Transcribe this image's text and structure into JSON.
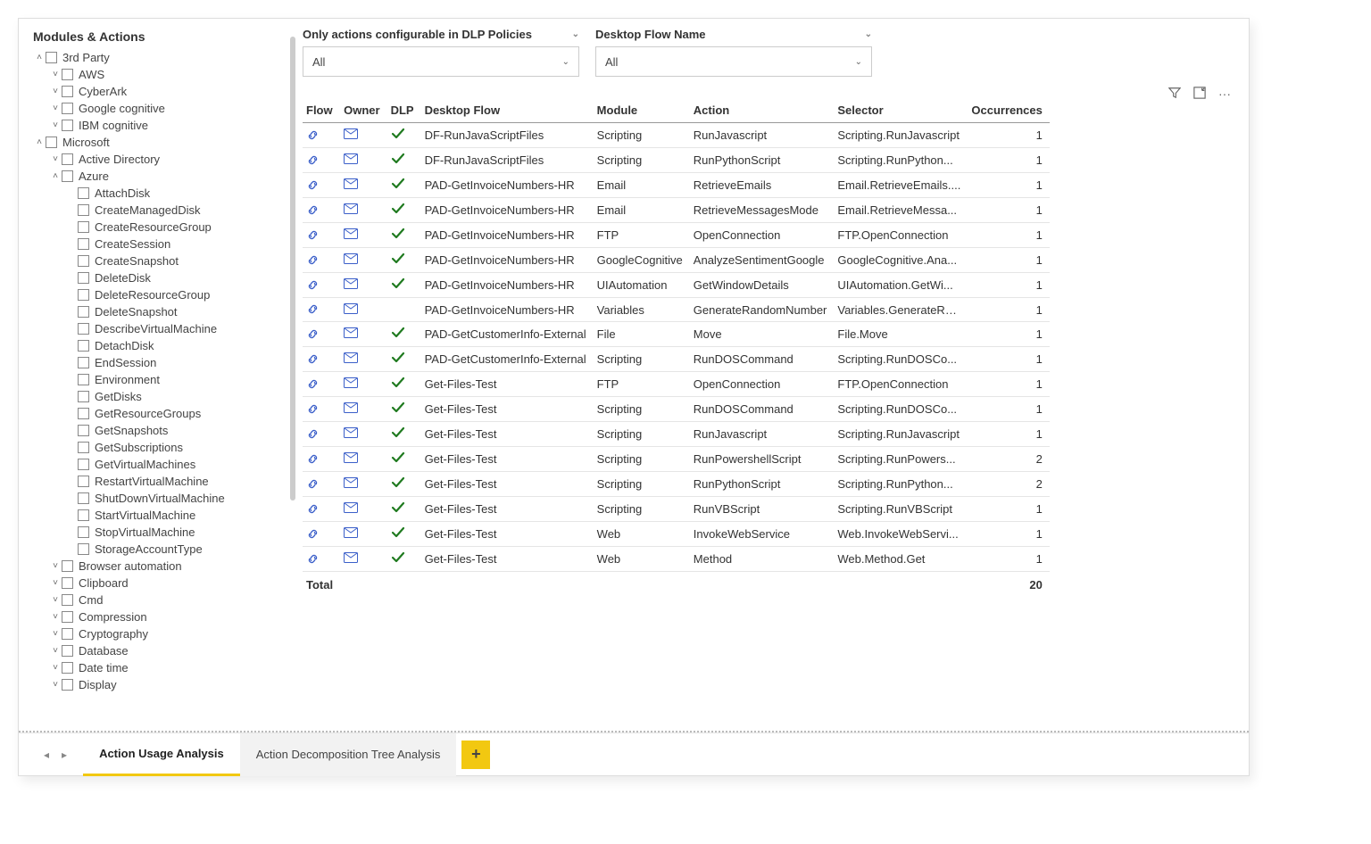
{
  "sidebar": {
    "title": "Modules & Actions",
    "tree": [
      {
        "level": 1,
        "chev": "up",
        "label": "3rd Party"
      },
      {
        "level": 2,
        "chev": "down",
        "label": "AWS"
      },
      {
        "level": 2,
        "chev": "down",
        "label": "CyberArk"
      },
      {
        "level": 2,
        "chev": "down",
        "label": "Google cognitive"
      },
      {
        "level": 2,
        "chev": "down",
        "label": "IBM cognitive"
      },
      {
        "level": 1,
        "chev": "up",
        "label": "Microsoft"
      },
      {
        "level": 2,
        "chev": "down",
        "label": "Active Directory"
      },
      {
        "level": 2,
        "chev": "up",
        "label": "Azure"
      },
      {
        "level": 3,
        "chev": "none",
        "label": "AttachDisk"
      },
      {
        "level": 3,
        "chev": "none",
        "label": "CreateManagedDisk"
      },
      {
        "level": 3,
        "chev": "none",
        "label": "CreateResourceGroup"
      },
      {
        "level": 3,
        "chev": "none",
        "label": "CreateSession"
      },
      {
        "level": 3,
        "chev": "none",
        "label": "CreateSnapshot"
      },
      {
        "level": 3,
        "chev": "none",
        "label": "DeleteDisk"
      },
      {
        "level": 3,
        "chev": "none",
        "label": "DeleteResourceGroup"
      },
      {
        "level": 3,
        "chev": "none",
        "label": "DeleteSnapshot"
      },
      {
        "level": 3,
        "chev": "none",
        "label": "DescribeVirtualMachine"
      },
      {
        "level": 3,
        "chev": "none",
        "label": "DetachDisk"
      },
      {
        "level": 3,
        "chev": "none",
        "label": "EndSession"
      },
      {
        "level": 3,
        "chev": "none",
        "label": "Environment"
      },
      {
        "level": 3,
        "chev": "none",
        "label": "GetDisks"
      },
      {
        "level": 3,
        "chev": "none",
        "label": "GetResourceGroups"
      },
      {
        "level": 3,
        "chev": "none",
        "label": "GetSnapshots"
      },
      {
        "level": 3,
        "chev": "none",
        "label": "GetSubscriptions"
      },
      {
        "level": 3,
        "chev": "none",
        "label": "GetVirtualMachines"
      },
      {
        "level": 3,
        "chev": "none",
        "label": "RestartVirtualMachine"
      },
      {
        "level": 3,
        "chev": "none",
        "label": "ShutDownVirtualMachine"
      },
      {
        "level": 3,
        "chev": "none",
        "label": "StartVirtualMachine"
      },
      {
        "level": 3,
        "chev": "none",
        "label": "StopVirtualMachine"
      },
      {
        "level": 3,
        "chev": "none",
        "label": "StorageAccountType"
      },
      {
        "level": 2,
        "chev": "down",
        "label": "Browser automation"
      },
      {
        "level": 2,
        "chev": "down",
        "label": "Clipboard"
      },
      {
        "level": 2,
        "chev": "down",
        "label": "Cmd"
      },
      {
        "level": 2,
        "chev": "down",
        "label": "Compression"
      },
      {
        "level": 2,
        "chev": "down",
        "label": "Cryptography"
      },
      {
        "level": 2,
        "chev": "down",
        "label": "Database"
      },
      {
        "level": 2,
        "chev": "down",
        "label": "Date time"
      },
      {
        "level": 2,
        "chev": "down",
        "label": "Display"
      }
    ]
  },
  "filters": {
    "dlp_label": "Only actions configurable in DLP Policies",
    "dlp_value": "All",
    "flowname_label": "Desktop Flow Name",
    "flowname_value": "All"
  },
  "table": {
    "headers": {
      "flow": "Flow",
      "owner": "Owner",
      "dlp": "DLP",
      "name": "Desktop Flow",
      "module": "Module",
      "action": "Action",
      "selector": "Selector",
      "occ": "Occurrences"
    },
    "rows": [
      {
        "dlp": true,
        "name": "DF-RunJavaScriptFiles",
        "module": "Scripting",
        "action": "RunJavascript",
        "selector": "Scripting.RunJavascript",
        "occ": 1
      },
      {
        "dlp": true,
        "name": "DF-RunJavaScriptFiles",
        "module": "Scripting",
        "action": "RunPythonScript",
        "selector": "Scripting.RunPython...",
        "occ": 1
      },
      {
        "dlp": true,
        "name": "PAD-GetInvoiceNumbers-HR",
        "module": "Email",
        "action": "RetrieveEmails",
        "selector": "Email.RetrieveEmails....",
        "occ": 1
      },
      {
        "dlp": true,
        "name": "PAD-GetInvoiceNumbers-HR",
        "module": "Email",
        "action": "RetrieveMessagesMode",
        "selector": "Email.RetrieveMessa...",
        "occ": 1
      },
      {
        "dlp": true,
        "name": "PAD-GetInvoiceNumbers-HR",
        "module": "FTP",
        "action": "OpenConnection",
        "selector": "FTP.OpenConnection",
        "occ": 1
      },
      {
        "dlp": true,
        "name": "PAD-GetInvoiceNumbers-HR",
        "module": "GoogleCognitive",
        "action": "AnalyzeSentimentGoogle",
        "selector": "GoogleCognitive.Ana...",
        "occ": 1
      },
      {
        "dlp": true,
        "name": "PAD-GetInvoiceNumbers-HR",
        "module": "UIAutomation",
        "action": "GetWindowDetails",
        "selector": "UIAutomation.GetWi...",
        "occ": 1
      },
      {
        "dlp": false,
        "name": "PAD-GetInvoiceNumbers-HR",
        "module": "Variables",
        "action": "GenerateRandomNumber",
        "selector": "Variables.GenerateRa...",
        "occ": 1
      },
      {
        "dlp": true,
        "name": "PAD-GetCustomerInfo-External",
        "module": "File",
        "action": "Move",
        "selector": "File.Move",
        "occ": 1
      },
      {
        "dlp": true,
        "name": "PAD-GetCustomerInfo-External",
        "module": "Scripting",
        "action": "RunDOSCommand",
        "selector": "Scripting.RunDOSCo...",
        "occ": 1
      },
      {
        "dlp": true,
        "name": "Get-Files-Test",
        "module": "FTP",
        "action": "OpenConnection",
        "selector": "FTP.OpenConnection",
        "occ": 1
      },
      {
        "dlp": true,
        "name": "Get-Files-Test",
        "module": "Scripting",
        "action": "RunDOSCommand",
        "selector": "Scripting.RunDOSCo...",
        "occ": 1
      },
      {
        "dlp": true,
        "name": "Get-Files-Test",
        "module": "Scripting",
        "action": "RunJavascript",
        "selector": "Scripting.RunJavascript",
        "occ": 1
      },
      {
        "dlp": true,
        "name": "Get-Files-Test",
        "module": "Scripting",
        "action": "RunPowershellScript",
        "selector": "Scripting.RunPowers...",
        "occ": 2
      },
      {
        "dlp": true,
        "name": "Get-Files-Test",
        "module": "Scripting",
        "action": "RunPythonScript",
        "selector": "Scripting.RunPython...",
        "occ": 2
      },
      {
        "dlp": true,
        "name": "Get-Files-Test",
        "module": "Scripting",
        "action": "RunVBScript",
        "selector": "Scripting.RunVBScript",
        "occ": 1
      },
      {
        "dlp": true,
        "name": "Get-Files-Test",
        "module": "Web",
        "action": "InvokeWebService",
        "selector": "Web.InvokeWebServi...",
        "occ": 1
      },
      {
        "dlp": true,
        "name": "Get-Files-Test",
        "module": "Web",
        "action": "Method",
        "selector": "Web.Method.Get",
        "occ": 1
      }
    ],
    "total_label": "Total",
    "total_value": 20
  },
  "tabs": {
    "active": "Action Usage Analysis",
    "other": "Action Decomposition Tree Analysis"
  }
}
